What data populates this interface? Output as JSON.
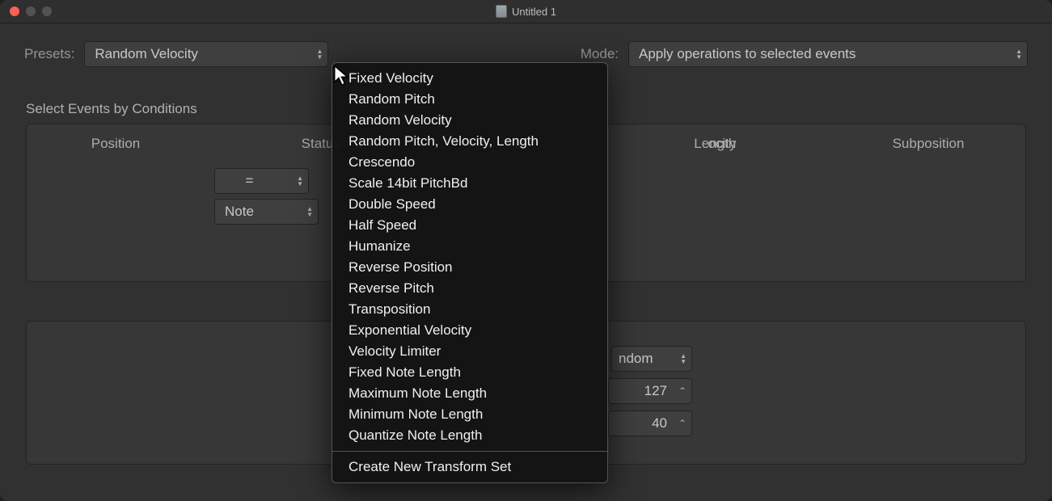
{
  "window": {
    "title": "Untitled 1"
  },
  "toprow": {
    "presets_label": "Presets:",
    "presets_value": "Random Velocity",
    "mode_label": "Mode:",
    "mode_value": "Apply operations to selected events"
  },
  "section1": {
    "label": "Select Events by Conditions",
    "columns": {
      "position": "Position",
      "status": "Status",
      "velocity": "ocity",
      "length": "Length",
      "subposition": "Subposition"
    },
    "status_op": "=",
    "status_type": "Note"
  },
  "section2": {
    "op_cell": "ndom",
    "val1": "127",
    "val2": "40"
  },
  "menu": {
    "items": [
      "Fixed Velocity",
      "Random Pitch",
      "Random Velocity",
      "Random Pitch, Velocity, Length",
      "Crescendo",
      "Scale 14bit PitchBd",
      "Double Speed",
      "Half Speed",
      "Humanize",
      "Reverse Position",
      "Reverse Pitch",
      "Transposition",
      "Exponential Velocity",
      "Velocity Limiter",
      "Fixed Note Length",
      "Maximum Note Length",
      "Minimum Note Length",
      "Quantize Note Length"
    ],
    "create": "Create New Transform Set"
  }
}
